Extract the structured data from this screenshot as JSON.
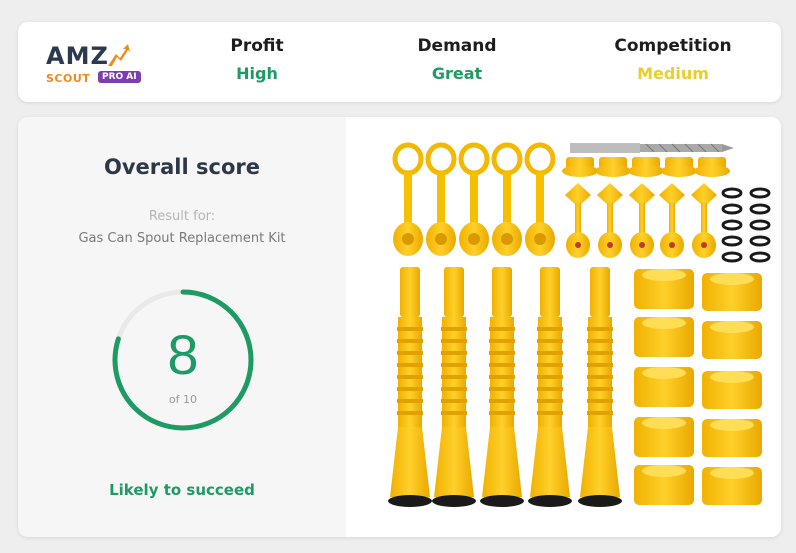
{
  "header": {
    "logo": {
      "brand": "AMZ",
      "sub": "SCOUT",
      "badge": "PRO AI"
    },
    "metrics": [
      {
        "label": "Profit",
        "value": "High",
        "color": "#1e9a64"
      },
      {
        "label": "Demand",
        "value": "Great",
        "color": "#1e9a64"
      },
      {
        "label": "Competition",
        "value": "Medium",
        "color": "#e8cf2a"
      }
    ]
  },
  "score": {
    "title": "Overall score",
    "result_for_label": "Result for:",
    "product_name": "Gas Can Spout Replacement Kit",
    "value": "8",
    "max_label": "of 10",
    "fraction": 0.8,
    "verdict": "Likely to succeed",
    "accent_color": "#1e9a64"
  },
  "product_image": {
    "subject": "yellow gas can spouts, caps, vent caps, nuts and black rubber gaskets with a drill bit",
    "color": "#ffc61a"
  }
}
